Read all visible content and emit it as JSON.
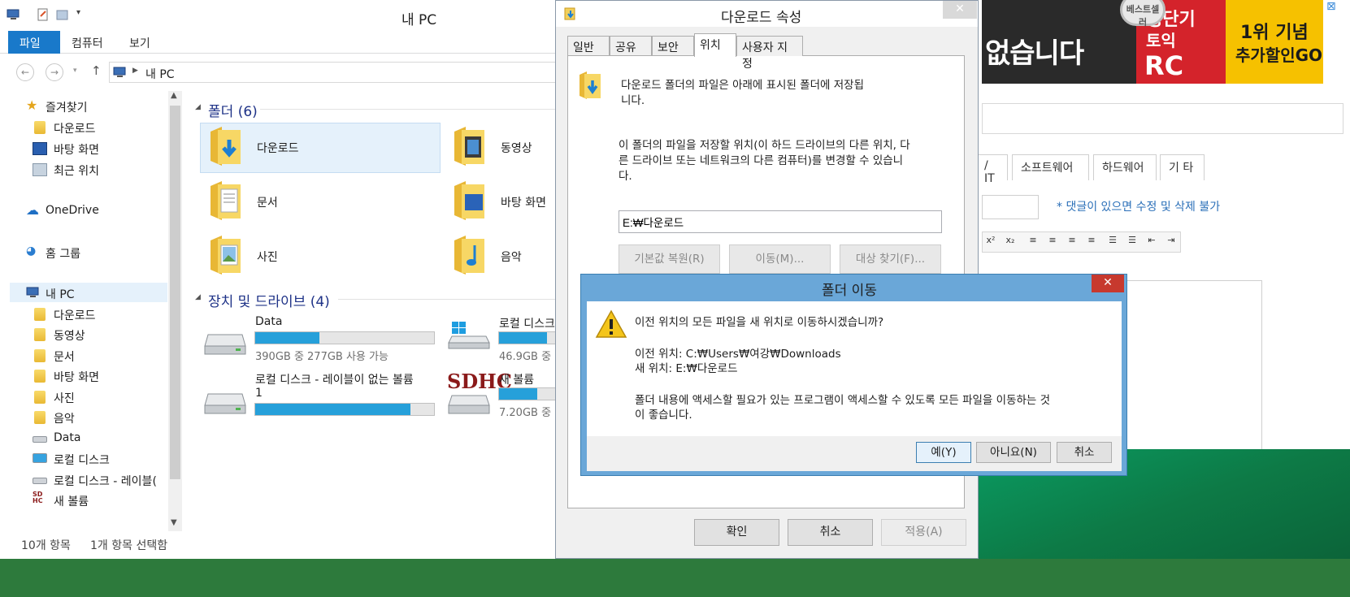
{
  "background": {
    "ad_text": "없습니다",
    "ad_red_lines": [
      "영단기",
      "토익",
      "RC"
    ],
    "ad_badge": "베스트셀러",
    "ad_yellow_lines": [
      "1위 기념",
      "추가할인GO"
    ],
    "ad_close": "⊠",
    "tabs": [
      "/ IT",
      "소프트웨어",
      "하드웨어",
      "기 타"
    ],
    "comment_note": "* 댓글이 있으면 수정 및 삭제 불가",
    "toolbar_buttons": [
      "x²",
      "x₂",
      "≡",
      "≡",
      "≡",
      "≡",
      "☰",
      "☰",
      "⇤",
      "⇥"
    ]
  },
  "explorer": {
    "title": "내 PC",
    "ribbon_tabs": [
      "파일",
      "컴퓨터",
      "보기"
    ],
    "address": "내 PC",
    "nav": {
      "favorites_label": "즐겨찾기",
      "favorites": [
        "다운로드",
        "바탕 화면",
        "최근 위치"
      ],
      "onedrive": "OneDrive",
      "homegroup": "홈 그룹",
      "this_pc": "내 PC",
      "pc_items": [
        "다운로드",
        "동영상",
        "문서",
        "바탕 화면",
        "사진",
        "음악",
        "Data",
        "로컬 디스크",
        "로컬 디스크 - 레이블(",
        "새 볼륨"
      ]
    },
    "folders_header": "폴더",
    "folders_count": "(6)",
    "folders": [
      "다운로드",
      "동영상",
      "문서",
      "바탕 화면",
      "사진",
      "음악"
    ],
    "drives_header": "장치 및 드라이브",
    "drives_count": "(4)",
    "drives": [
      {
        "name": "Data",
        "free": "390GB 중 277GB 사용 가능",
        "fill": 0.36
      },
      {
        "name": "로컬 디스크",
        "free": "46.9GB 중",
        "fill": 0.75
      },
      {
        "name": "로컬 디스크 - 레이블이 없는 볼륨",
        "name2": "1",
        "free": "",
        "fill": 0.87
      },
      {
        "name": "새 볼륨",
        "free": "7.20GB 중",
        "fill": 0.6
      }
    ],
    "sdhc_label": "SDHC",
    "status_items": "10개 항목",
    "status_selected": "1개 항목 선택함"
  },
  "props": {
    "title": "다운로드 속성",
    "close": "✕",
    "tabs": [
      "일반",
      "공유",
      "보안",
      "위치",
      "사용자 지정"
    ],
    "desc1_line1": "다운로드 폴더의 파일은 아래에 표시된 폴더에 저장됩",
    "desc1_line2": "니다.",
    "desc2_line1": "이 폴더의 파일을 저장할 위치(이 하드 드라이브의 다른 위치, 다",
    "desc2_line2": "른 드라이브 또는 네트워크의 다른 컴퓨터)를 변경할 수 있습니",
    "desc2_line3": "다.",
    "path": "E:₩다운로드",
    "restore_btn": "기본값 복원(R)",
    "move_btn": "이동(M)...",
    "find_btn": "대상 찾기(F)...",
    "ok_btn": "확인",
    "cancel_btn": "취소",
    "apply_btn": "적용(A)"
  },
  "move_dialog": {
    "title": "폴더 이동",
    "close": "✕",
    "question": "이전 위치의 모든 파일을 새 위치로 이동하시겠습니까?",
    "old_location": "이전 위치: C:₩Users₩여강₩Downloads",
    "new_location": "새 위치: E:₩다운로드",
    "advice_line1": "폴더 내용에 액세스할 필요가 있는 프로그램이 액세스할 수 있도록 모든 파일을 이동하는 것",
    "advice_line2": "이 좋습니다.",
    "yes_btn": "예(Y)",
    "no_btn": "아니요(N)",
    "cancel_btn": "취소"
  }
}
